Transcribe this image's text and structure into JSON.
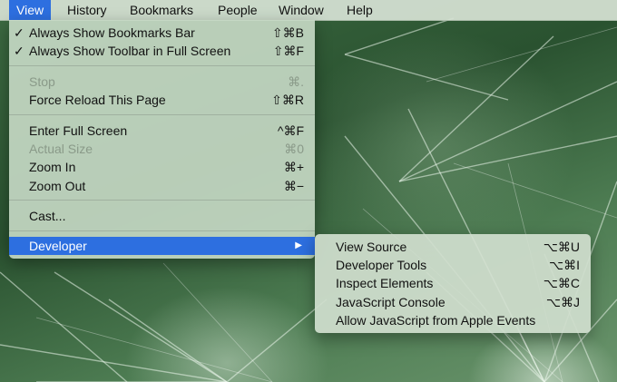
{
  "menubar": {
    "items": [
      {
        "label": "View"
      },
      {
        "label": "History"
      },
      {
        "label": "Bookmarks"
      },
      {
        "label": "People"
      },
      {
        "label": "Window"
      },
      {
        "label": "Help"
      }
    ]
  },
  "view_menu": {
    "items": [
      {
        "label": "Always Show Bookmarks Bar",
        "shortcut": "⇧⌘B",
        "checked": "✓"
      },
      {
        "label": "Always Show Toolbar in Full Screen",
        "shortcut": "⇧⌘F",
        "checked": "✓"
      },
      {
        "label": "Stop",
        "shortcut": "⌘."
      },
      {
        "label": "Force Reload This Page",
        "shortcut": "⇧⌘R"
      },
      {
        "label": "Enter Full Screen",
        "shortcut": "^⌘F"
      },
      {
        "label": "Actual Size",
        "shortcut": "⌘0"
      },
      {
        "label": "Zoom In",
        "shortcut": "⌘+"
      },
      {
        "label": "Zoom Out",
        "shortcut": "⌘−"
      },
      {
        "label": "Cast..."
      },
      {
        "label": "Developer",
        "arrow": "▶"
      }
    ]
  },
  "developer_submenu": {
    "items": [
      {
        "label": "View Source",
        "shortcut": "⌥⌘U"
      },
      {
        "label": "Developer Tools",
        "shortcut": "⌥⌘I"
      },
      {
        "label": "Inspect Elements",
        "shortcut": "⌥⌘C"
      },
      {
        "label": "JavaScript Console",
        "shortcut": "⌥⌘J"
      },
      {
        "label": "Allow JavaScript from Apple Events"
      }
    ]
  },
  "colors": {
    "highlight": "#2d6fe0",
    "disabled_text": "#8a9a89"
  }
}
